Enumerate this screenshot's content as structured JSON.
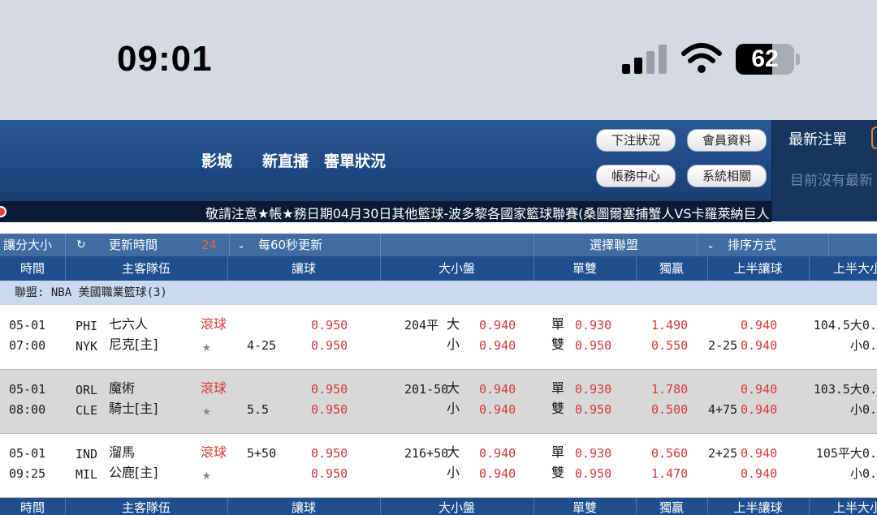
{
  "status_bar": {
    "time": "09:01",
    "battery": "62",
    "battery_level": 0.62
  },
  "header": {
    "nav": [
      "影城",
      "新直播",
      "審單狀況"
    ],
    "buttons": [
      "下注狀況",
      "會員資料",
      "帳務中心",
      "系統相關"
    ],
    "latest_title": "最新注單",
    "latest_empty": "目前沒有最新"
  },
  "marquee": {
    "text": "敬請注意★帳★務日期04月30日其他籃球-波多黎各國家籃球聯賽(桑圖爾塞捕蟹人VS卡羅萊納巨人"
  },
  "toolbar": {
    "market": "讓分大小",
    "refresh_label": "更新時間",
    "refresh_count": "24",
    "auto_refresh": "每60秒更新",
    "league_select": "選擇聯盟",
    "sort": "排序方式"
  },
  "columns": [
    "時間",
    "主客隊伍",
    "讓球",
    "大小盤",
    "單雙",
    "獨贏",
    "上半讓球",
    "上半大小"
  ],
  "league": "聯盟: NBA 美國職業籃球(3)",
  "matches": [
    {
      "date": "05-01",
      "time": "07:00",
      "away_code": "PHI",
      "away_name": "七六人",
      "home_code": "NYK",
      "home_name": "尼克[主]",
      "live": "滾球",
      "star": "★",
      "hcp_top": "",
      "hcp_bottom": "4-25",
      "hcp_odds_top": "0.950",
      "hcp_odds_bottom": "0.950",
      "ou_line": "204平",
      "ou_over": "大",
      "ou_under": "小",
      "ou_odds_top": "0.940",
      "ou_odds_bottom": "0.940",
      "odd": "單",
      "even": "雙",
      "oe_odds_top": "0.930",
      "oe_odds_bottom": "0.950",
      "ml_top": "1.490",
      "ml_bottom": "0.550",
      "h1_hcp_top": "",
      "h1_hcp_bottom": "2-25",
      "h1_hcp_odds_top": "0.940",
      "h1_hcp_odds_bottom": "0.940",
      "h1_ou_top": "104.5大0.",
      "h1_ou_bottom": "小0."
    },
    {
      "date": "05-01",
      "time": "08:00",
      "away_code": "ORL",
      "away_name": "魔術",
      "home_code": "CLE",
      "home_name": "騎士[主]",
      "live": "滾球",
      "star": "★",
      "hcp_top": "",
      "hcp_bottom": "5.5",
      "hcp_odds_top": "0.950",
      "hcp_odds_bottom": "0.950",
      "ou_line": "201-50",
      "ou_over": "大",
      "ou_under": "小",
      "ou_odds_top": "0.940",
      "ou_odds_bottom": "0.940",
      "odd": "單",
      "even": "雙",
      "oe_odds_top": "0.930",
      "oe_odds_bottom": "0.950",
      "ml_top": "1.780",
      "ml_bottom": "0.500",
      "h1_hcp_top": "",
      "h1_hcp_bottom": "4+75",
      "h1_hcp_odds_top": "0.940",
      "h1_hcp_odds_bottom": "0.940",
      "h1_ou_top": "103.5大0.",
      "h1_ou_bottom": "小0."
    },
    {
      "date": "05-01",
      "time": "09:25",
      "away_code": "IND",
      "away_name": "溜馬",
      "home_code": "MIL",
      "home_name": "公鹿[主]",
      "live": "滾球",
      "star": "★",
      "hcp_top": "5+50",
      "hcp_bottom": "",
      "hcp_odds_top": "0.950",
      "hcp_odds_bottom": "0.950",
      "ou_line": "216+50",
      "ou_over": "大",
      "ou_under": "小",
      "ou_odds_top": "0.940",
      "ou_odds_bottom": "0.940",
      "odd": "單",
      "even": "雙",
      "oe_odds_top": "0.930",
      "oe_odds_bottom": "0.950",
      "ml_top": "0.560",
      "ml_bottom": "1.470",
      "h1_hcp_top": "2+25",
      "h1_hcp_bottom": "",
      "h1_hcp_odds_top": "0.940",
      "h1_hcp_odds_bottom": "0.940",
      "h1_ou_top": "105平大0.",
      "h1_ou_bottom": "小0."
    }
  ],
  "colors": {
    "header_blue": "#1f4a85",
    "column_header": "#1f4f8f",
    "league_row": "#c9d9ef",
    "odds_red": "#d43a3a",
    "grey_row": "#d8d8d8"
  }
}
